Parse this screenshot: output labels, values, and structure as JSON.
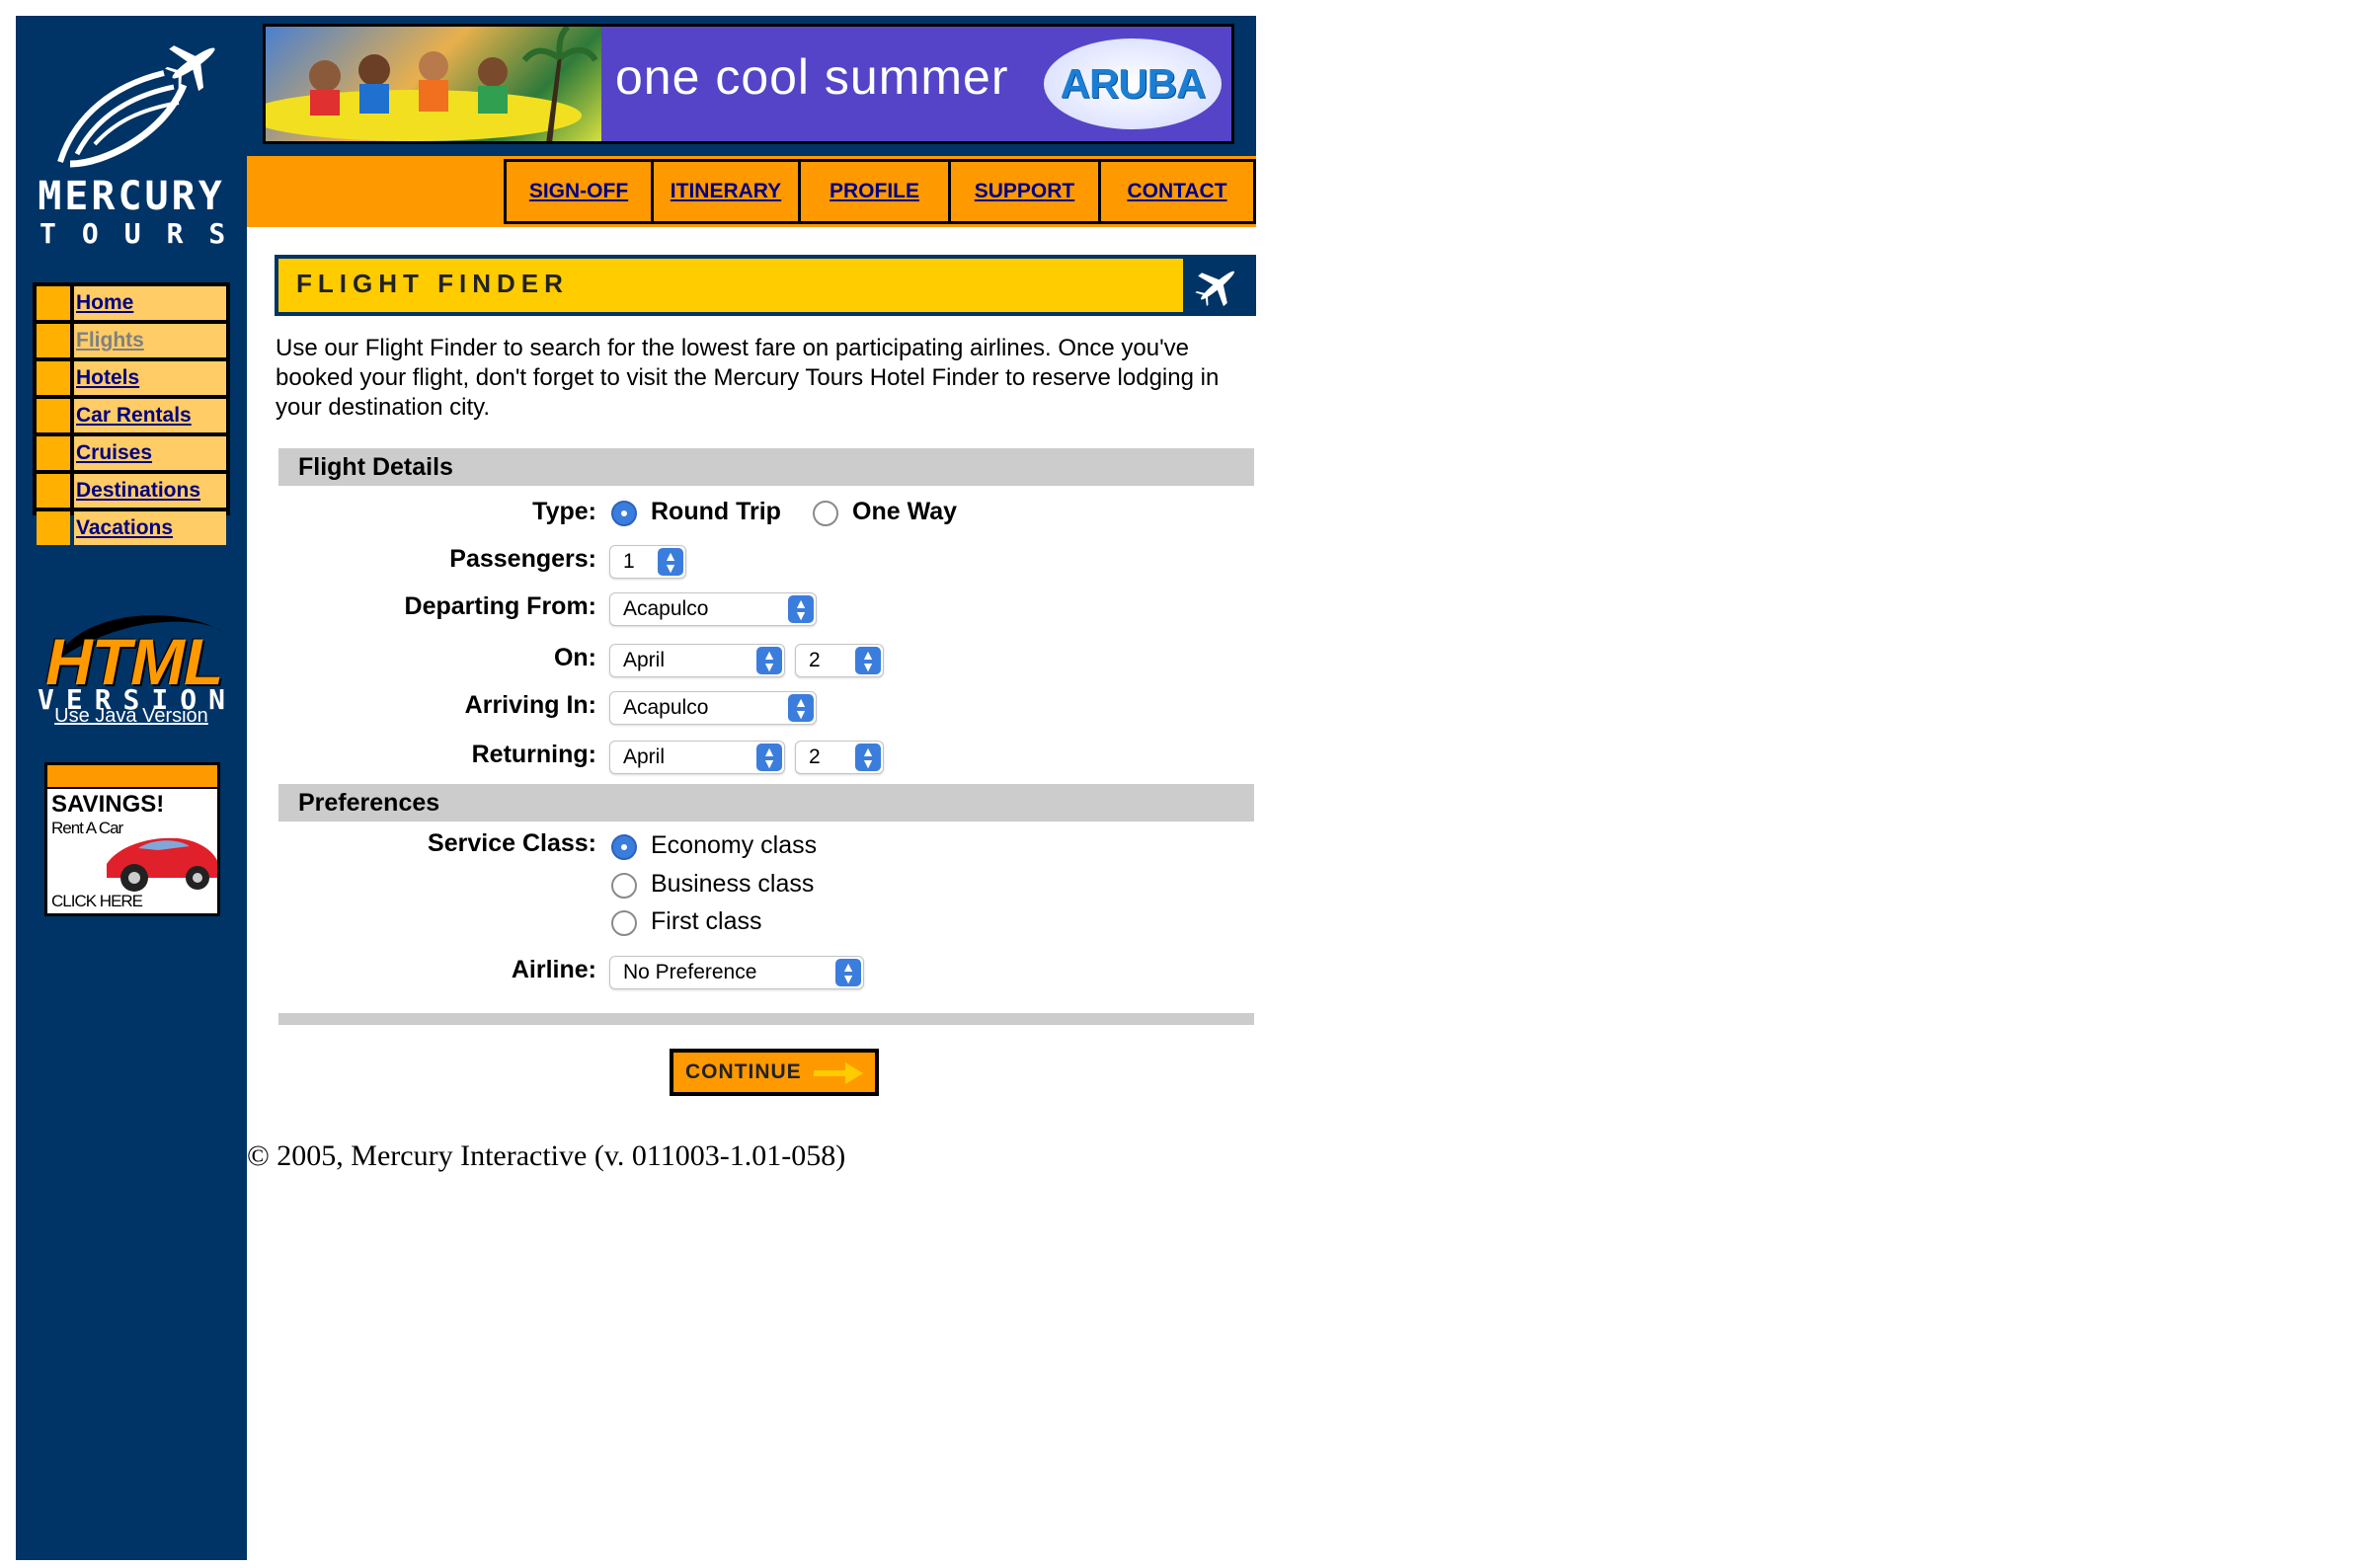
{
  "brand": {
    "line1": "MERCURY",
    "line2": "TOURS"
  },
  "sidebar": {
    "items": [
      {
        "label": "Home",
        "current": false
      },
      {
        "label": "Flights",
        "current": true
      },
      {
        "label": "Hotels",
        "current": false
      },
      {
        "label": "Car Rentals",
        "current": false
      },
      {
        "label": "Cruises",
        "current": false
      },
      {
        "label": "Destinations",
        "current": false
      },
      {
        "label": "Vacations",
        "current": false
      }
    ],
    "html_version": {
      "big": "HTML",
      "small": "VERSION"
    },
    "java_link": "Use Java Version",
    "savings_ad": {
      "title": "SAVINGS!",
      "sub": "Rent A Car",
      "cta": "CLICK HERE"
    }
  },
  "banner": {
    "tagline": "one cool summer",
    "badge": "ARUBA"
  },
  "topnav": {
    "items": [
      "SIGN-OFF",
      "ITINERARY",
      "PROFILE",
      "SUPPORT",
      "CONTACT"
    ]
  },
  "finder": {
    "title": "FLIGHT FINDER",
    "intro": "Use our Flight Finder to search for the lowest fare on participating airlines. Once you've booked your flight, don't forget to visit the Mercury Tours Hotel Finder to reserve lodging in your destination city."
  },
  "flight_details": {
    "heading": "Flight Details",
    "type": {
      "label": "Type:",
      "options": [
        "Round Trip",
        "One Way"
      ],
      "selected": "Round Trip"
    },
    "passengers": {
      "label": "Passengers:",
      "value": "1"
    },
    "departing": {
      "label": "Departing From:",
      "value": "Acapulco"
    },
    "on": {
      "label": "On:",
      "month": "April",
      "day": "2"
    },
    "arriving": {
      "label": "Arriving In:",
      "value": "Acapulco"
    },
    "returning": {
      "label": "Returning:",
      "month": "April",
      "day": "2"
    }
  },
  "preferences": {
    "heading": "Preferences",
    "service_class": {
      "label": "Service Class:",
      "options": [
        "Economy class",
        "Business class",
        "First class"
      ],
      "selected": "Economy class"
    },
    "airline": {
      "label": "Airline:",
      "value": "No Preference"
    }
  },
  "continue_label": "CONTINUE",
  "footer": "© 2005, Mercury Interactive (v. 011003-1.01-058)",
  "colors": {
    "navy": "#003366",
    "orange": "#ff9900",
    "yellow": "#ffcc00",
    "menu_cell": "#ffcc66",
    "radio_on": "#3b7ddd"
  }
}
